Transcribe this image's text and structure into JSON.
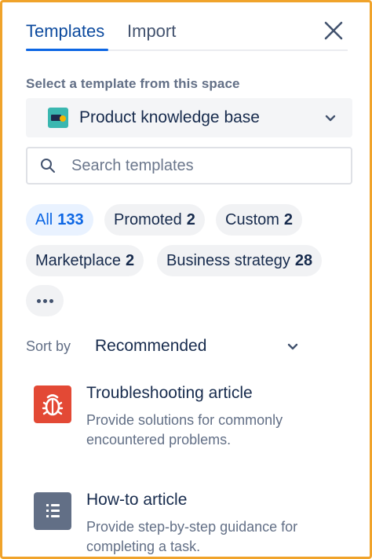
{
  "tabs": [
    {
      "label": "Templates",
      "active": true
    },
    {
      "label": "Import",
      "active": false
    }
  ],
  "close_icon": "close-icon",
  "space_section": {
    "label": "Select a template from this space",
    "selected_space": "Product knowledge base"
  },
  "search": {
    "placeholder": "Search templates",
    "value": ""
  },
  "filters": [
    {
      "label": "All",
      "count": "133",
      "active": true
    },
    {
      "label": "Promoted",
      "count": "2",
      "active": false
    },
    {
      "label": "Custom",
      "count": "2",
      "active": false
    },
    {
      "label": "Marketplace",
      "count": "2",
      "active": false
    },
    {
      "label": "Business strategy",
      "count": "28",
      "active": false
    }
  ],
  "more_filters_icon": "more-icon",
  "sort": {
    "label": "Sort by",
    "value": "Recommended"
  },
  "templates": [
    {
      "title": "Troubleshooting article",
      "description": "Provide solutions for commonly encountered problems.",
      "icon": "bug-icon",
      "icon_color": "#e34935"
    },
    {
      "title": "How-to article",
      "description": "Provide step-by-step guidance for completing a task.",
      "icon": "numbered-list-icon",
      "icon_color": "#626f86"
    }
  ],
  "colors": {
    "accent": "#0c66e4",
    "frame": "#f0a32b"
  }
}
